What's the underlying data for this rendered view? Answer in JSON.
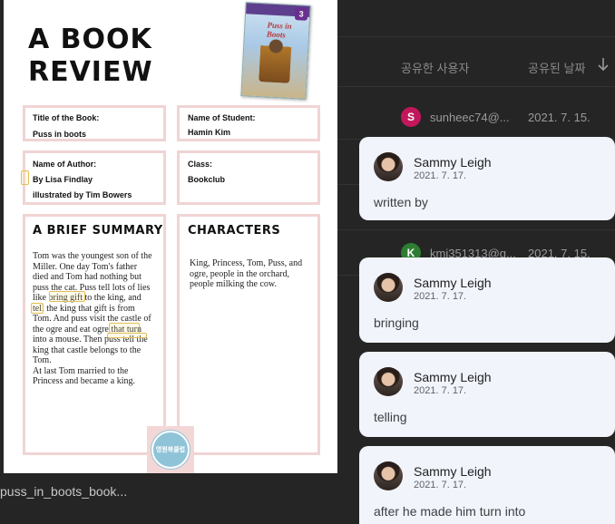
{
  "file_list": {
    "columns": {
      "shared_by": "공유한 사용자",
      "shared_date": "공유된 날짜"
    },
    "rows": [
      {
        "avatar_letter": "S",
        "avatar_color": "#c2185b",
        "user": "sunheec74@...",
        "date": "2021. 7. 15."
      },
      {
        "avatar_letter": "K",
        "avatar_color": "#2e7d32",
        "user": "kmj351313@g...",
        "date": "2021. 7. 15."
      }
    ],
    "filename": "puss_in_boots_book..."
  },
  "document": {
    "title_line1": "A BOOK",
    "title_line2": "REVIEW",
    "cover": {
      "series_number": "3",
      "title": "Puss in Boots"
    },
    "title_of_book_label": "Title of the Book:",
    "title_of_book_value": "Puss in boots",
    "student_label": "Name of Student:",
    "student_value": "Hamin Kim",
    "author_label": "Name of Author:",
    "author_line1": "By Lisa Findlay",
    "author_line2": "illustrated by Tim Bowers",
    "class_label": "Class:",
    "class_value": "Bookclub",
    "summary_heading": "A BRIEF SUMMARY",
    "summary_lines": [
      "Tom was the youngest son of the",
      "Miller. One day Tom's father",
      "died and Tom had nothing but",
      "puss the cat. Puss tell lots of lies",
      "like bring gift to the king, and",
      "tell the king that gift is from",
      "Tom. And puss visit the castle of",
      "the ogre and eat ogre that turn",
      "into a mouse. Then puss tell the",
      "king that castle belongs to the",
      "Tom.",
      "At last Tom married to the",
      "Princess and became a king."
    ],
    "characters_heading": "CHARACTERS",
    "characters_lines": [
      "King, Princess, Tom, Puss, and",
      "ogre, people in the orchard,",
      "people milking the cow."
    ],
    "stamp_text": "영원북클럽"
  },
  "comments": [
    {
      "author": "Sammy Leigh",
      "date": "2021. 7. 17.",
      "text": "written by"
    },
    {
      "author": "Sammy Leigh",
      "date": "2021. 7. 17.",
      "text": "bringing"
    },
    {
      "author": "Sammy Leigh",
      "date": "2021. 7. 17.",
      "text": "telling"
    },
    {
      "author": "Sammy Leigh",
      "date": "2021. 7. 17.",
      "text": "after he made him turn into"
    }
  ]
}
